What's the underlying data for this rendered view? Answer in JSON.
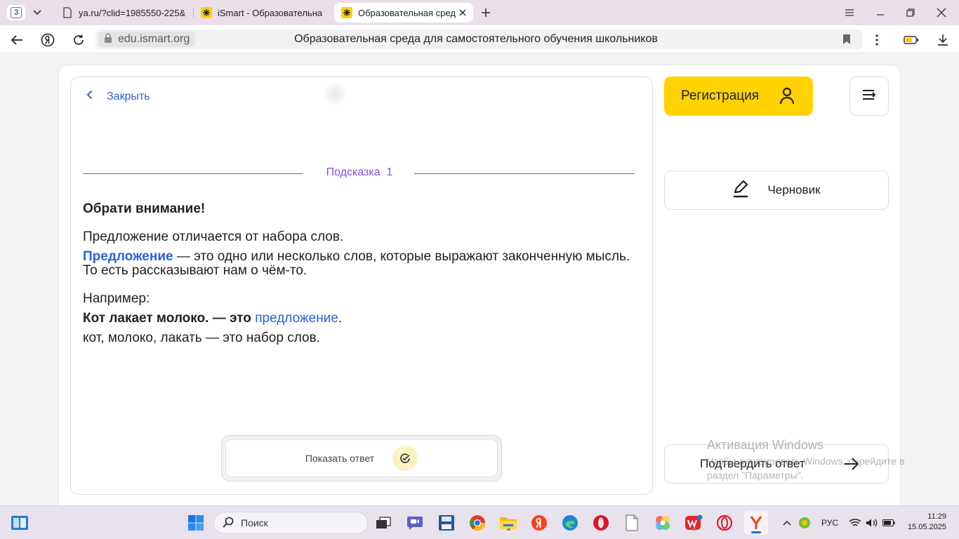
{
  "browser": {
    "tab_count": "3",
    "tabs": [
      {
        "title": "ya.ru/?clid=1985550-225&"
      },
      {
        "title": "iSmart - Образовательна"
      },
      {
        "title": "Образовательная сред"
      }
    ],
    "url": "edu.ismart.org",
    "page_title": "Образовательная среда для самостоятельного обучения школьников"
  },
  "hint_panel": {
    "close_label": "Закрыть",
    "hint_label": "Подсказка",
    "hint_number": "1",
    "heading": "Обрати внимание!",
    "p1": "Предложение отличается от набора слов.",
    "p2_term": "Предложение",
    "p2_rest": " — это одно или несколько слов, которые выражают законченную мысль. То есть рассказывают нам о чём-то.",
    "example_label": "Например:",
    "example1_bold": "Кот лакает молоко. — это ",
    "example1_term": "предложение",
    "example1_end": ".",
    "example2": "кот, молоко, лакать — это набор слов.",
    "show_answer_label": "Показать ответ"
  },
  "sidebar": {
    "register_label": "Регистрация",
    "draft_label": "Черновик",
    "confirm_label": "Подтвердить ответ"
  },
  "watermark": {
    "title": "Активация Windows",
    "subtitle": "Чтобы активировать Windows, перейдите в раздел \"Параметры\"."
  },
  "taskbar": {
    "search_placeholder": "Поиск",
    "language": "РУС",
    "time": "11:29",
    "date": "15.05.2025"
  },
  "colors": {
    "accent_blue": "#2a63d4",
    "hint_purple": "#8a4ee0",
    "brand_yellow": "#ffd200"
  }
}
